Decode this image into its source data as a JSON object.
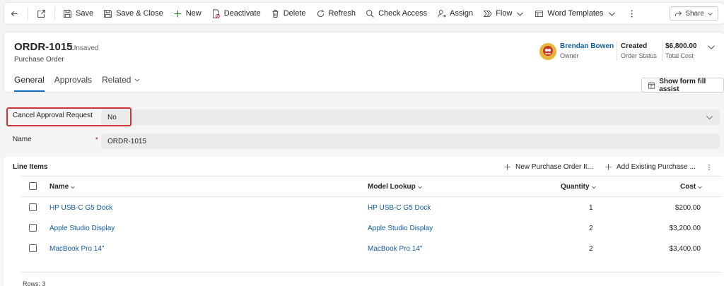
{
  "toolbar": {
    "items": [
      {
        "label": "Save",
        "icon": "save-icon"
      },
      {
        "label": "Save & Close",
        "icon": "save-close-icon"
      },
      {
        "label": "New",
        "icon": "plus-icon"
      },
      {
        "label": "Deactivate",
        "icon": "deactivate-icon"
      },
      {
        "label": "Delete",
        "icon": "trash-icon"
      },
      {
        "label": "Refresh",
        "icon": "refresh-icon"
      },
      {
        "label": "Check Access",
        "icon": "check-access-icon"
      },
      {
        "label": "Assign",
        "icon": "assign-icon"
      },
      {
        "label": "Flow",
        "icon": "flow-icon"
      },
      {
        "label": "Word Templates",
        "icon": "word-template-icon"
      }
    ],
    "share_label": "Share"
  },
  "header": {
    "title": "ORDR-1015",
    "save_status": "- Unsaved",
    "entity": "Purchase Order",
    "owner_name": "Brendan Bowen",
    "owner_label": "Owner",
    "status_value": "Created",
    "status_label": "Order Status",
    "cost_value": "$6,800.00",
    "cost_label": "Total Cost",
    "tabs": [
      "General",
      "Approvals",
      "Related"
    ]
  },
  "form": {
    "assist_label": "Show form fill assist",
    "cancel_label": "Cancel Approval Request",
    "cancel_value": "No",
    "name_label": "Name",
    "required_marker": "*",
    "name_value": "ORDR-1015"
  },
  "line_items": {
    "title": "Line Items",
    "new_label": "New Purchase Order It...",
    "add_existing_label": "Add Existing Purchase ...",
    "columns": [
      "Name",
      "Model Lookup",
      "Quantity",
      "Cost"
    ],
    "rows": [
      {
        "name": "HP USB-C G5 Dock",
        "model": "HP USB-C G5 Dock",
        "quantity": "1",
        "cost": "$200.00"
      },
      {
        "name": "Apple Studio Display",
        "model": "Apple Studio Display",
        "quantity": "2",
        "cost": "$3,200.00"
      },
      {
        "name": "MacBook Pro 14\"",
        "model": "MacBook Pro 14\"",
        "quantity": "2",
        "cost": "$3,400.00"
      }
    ],
    "row_count": "Rows: 3"
  },
  "colors": {
    "accent": "#0f6cbd",
    "link": "#115ea3",
    "highlight": "#d13438"
  }
}
